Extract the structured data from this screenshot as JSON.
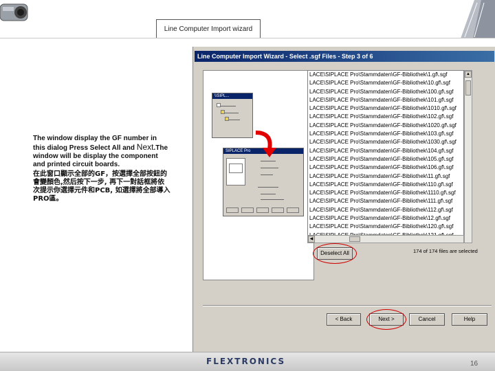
{
  "slide": {
    "header_title": "Line Computer Import wizard",
    "footer_logo": "FLEXTRONICS",
    "page_number": "16"
  },
  "caption": {
    "line1": "The window display the GF number in this dialog Press Select All and ",
    "next_word": "Next",
    "line2": ".The window  will be display the component and printed circuit boards.",
    "chinese": "在此窗口顯示全部的GF，按選擇全部按鈕的會變顏色,然后按下一步, 再下一對話框將依次提示你選擇元件和PCB, 如選擇將全部導入PRO區。"
  },
  "wizard": {
    "title": "Line Computer Import Wizard - Select .sgf Files - Step 3 of 6",
    "files": [
      "LACE\\SIPLACE Pro\\Stammdaten\\GF-Bibliothek\\1.gf\\.sgf",
      "LACE\\SIPLACE Pro\\Stammdaten\\GF-Bibliothek\\10.gf\\.sgf",
      "LACE\\SIPLACE Pro\\Stammdaten\\GF-Bibliothek\\100.gf\\.sgf",
      "LACE\\SIPLACE Pro\\Stammdaten\\GF-Bibliothek\\101.gf\\.sgf",
      "LACE\\SIPLACE Pro\\Stammdaten\\GF-Bibliothek\\1010.gf\\.sgf",
      "LACE\\SIPLACE Pro\\Stammdaten\\GF-Bibliothek\\102.gf\\.sgf",
      "LACE\\SIPLACE Pro\\Stammdaten\\GF-Bibliothek\\1020.gf\\.sgf",
      "LACE\\SIPLACE Pro\\Stammdaten\\GF-Bibliothek\\103.gf\\.sgf",
      "LACE\\SIPLACE Pro\\Stammdaten\\GF-Bibliothek\\1030.gf\\.sgf",
      "LACE\\SIPLACE Pro\\Stammdaten\\GF-Bibliothek\\104.gf\\.sgf",
      "LACE\\SIPLACE Pro\\Stammdaten\\GF-Bibliothek\\105.gf\\.sgf",
      "LACE\\SIPLACE Pro\\Stammdaten\\GF-Bibliothek\\106.gf\\.sgf",
      "LACE\\SIPLACE Pro\\Stammdaten\\GF-Bibliothek\\11.gf\\.sgf",
      "LACE\\SIPLACE Pro\\Stammdaten\\GF-Bibliothek\\110.gf\\.sgf",
      "LACE\\SIPLACE Pro\\Stammdaten\\GF-Bibliothek\\1110.gf\\.sgf",
      "LACE\\SIPLACE Pro\\Stammdaten\\GF-Bibliothek\\111.gf\\.sgf",
      "LACE\\SIPLACE Pro\\Stammdaten\\GF-Bibliothek\\112.gf\\.sgf",
      "LACE\\SIPLACE Pro\\Stammdaten\\GF-Bibliothek\\12.gf\\.sgf",
      "LACE\\SIPLACE Pro\\Stammdaten\\GF-Bibliothek\\120.gf\\.sgf",
      "LACE\\SIPLACE Pro\\Stammdaten\\GF-Bibliothek\\121.gf\\.sgf"
    ],
    "deselect_label": "Deselect All",
    "status": "174 of 174 files are selected",
    "buttons": {
      "back": "< Back",
      "next": "Next >",
      "cancel": "Cancel",
      "help": "Help"
    }
  },
  "colors": {
    "title_bar": "#0a246a",
    "highlight": "#d00000",
    "dialog_face": "#d4d0c8"
  }
}
